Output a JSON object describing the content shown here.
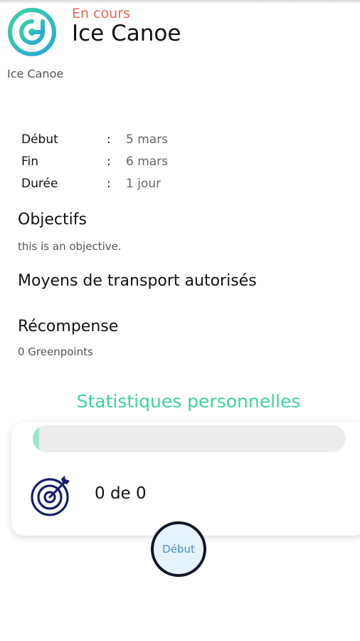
{
  "header": {
    "status": "En cours",
    "title": "Ice Canoe",
    "subtitle": "Ice Canoe"
  },
  "info": {
    "rows": [
      {
        "label": "Début",
        "value": "5 mars"
      },
      {
        "label": "Fin",
        "value": "6 mars"
      },
      {
        "label": "Durée",
        "value": "1 jour"
      }
    ],
    "separator": ":"
  },
  "objectives": {
    "heading": "Objectifs",
    "text": "this is an objective."
  },
  "transport": {
    "heading": "Moyens de transport autorisés"
  },
  "reward": {
    "heading": "Récompense",
    "text": "0 Greenpoints"
  },
  "stats": {
    "title": "Statistiques personnelles",
    "progress_fraction": 0.02,
    "count_text": "0 de 0"
  },
  "start_button": {
    "label": "Début"
  },
  "colors": {
    "accent": "#3fd1a2",
    "status": "#e8665a",
    "icon_navy": "#16206a",
    "button_blue": "#4a90c5"
  },
  "icons": {
    "logo": "app-logo-icon",
    "target": "target-arrow-icon"
  }
}
